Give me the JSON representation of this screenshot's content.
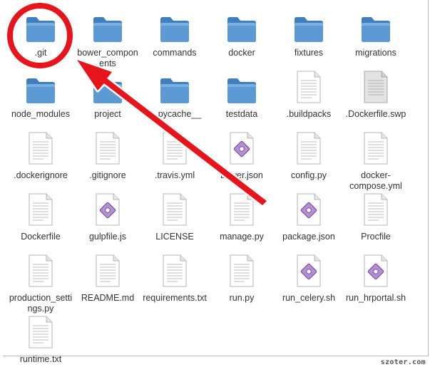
{
  "files": [
    {
      "name": ".git",
      "type": "folder"
    },
    {
      "name": "bower_components",
      "type": "folder"
    },
    {
      "name": "commands",
      "type": "folder"
    },
    {
      "name": "docker",
      "type": "folder"
    },
    {
      "name": "fixtures",
      "type": "folder"
    },
    {
      "name": "migrations",
      "type": "folder"
    },
    {
      "name": "node_modules",
      "type": "folder"
    },
    {
      "name": "project",
      "type": "folder"
    },
    {
      "name": "__pycache__",
      "type": "folder"
    },
    {
      "name": "testdata",
      "type": "folder"
    },
    {
      "name": ".buildpacks",
      "type": "text"
    },
    {
      "name": ".Dockerfile.swp",
      "type": "binary"
    },
    {
      "name": ".dockerignore",
      "type": "text"
    },
    {
      "name": ".gitignore",
      "type": "text"
    },
    {
      "name": ".travis.yml",
      "type": "text"
    },
    {
      "name": "bower.json",
      "type": "script"
    },
    {
      "name": "config.py",
      "type": "text"
    },
    {
      "name": "docker-compose.yml",
      "type": "text"
    },
    {
      "name": "Dockerfile",
      "type": "text"
    },
    {
      "name": "gulpfile.js",
      "type": "script"
    },
    {
      "name": "LICENSE",
      "type": "text"
    },
    {
      "name": "manage.py",
      "type": "text"
    },
    {
      "name": "package.json",
      "type": "script"
    },
    {
      "name": "Procfile",
      "type": "text"
    },
    {
      "name": "production_settings.py",
      "type": "text"
    },
    {
      "name": "README.md",
      "type": "text"
    },
    {
      "name": "requirements.txt",
      "type": "text"
    },
    {
      "name": "run.py",
      "type": "text"
    },
    {
      "name": "run_celery.sh",
      "type": "script"
    },
    {
      "name": "run_hrportal.sh",
      "type": "script"
    },
    {
      "name": "runtime.txt",
      "type": "text"
    }
  ],
  "watermark": "szoter.com",
  "annotation": {
    "shape": "circle-and-arrow",
    "color": "#e8141b",
    "target": ".git"
  }
}
